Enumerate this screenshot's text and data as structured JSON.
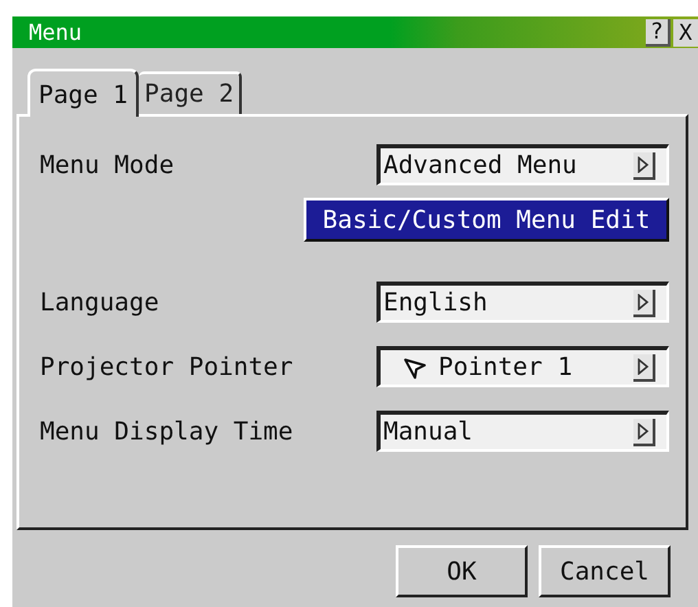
{
  "window": {
    "title": "Menu",
    "help_glyph": "?",
    "close_glyph": "X"
  },
  "tabs": [
    {
      "label": "Page 1",
      "selected": true
    },
    {
      "label": "Page 2",
      "selected": false
    }
  ],
  "settings": [
    {
      "kind": "select",
      "label": "Menu Mode",
      "value": "Advanced Menu"
    },
    {
      "kind": "button",
      "label": "Basic/Custom Menu Edit"
    },
    {
      "kind": "select",
      "label": "Language",
      "value": "English"
    },
    {
      "kind": "pointer-select",
      "label": "Projector Pointer",
      "value": "Pointer 1"
    },
    {
      "kind": "select",
      "label": "Menu Display Time",
      "value": "Manual"
    }
  ],
  "buttons": [
    "OK",
    "Cancel"
  ]
}
